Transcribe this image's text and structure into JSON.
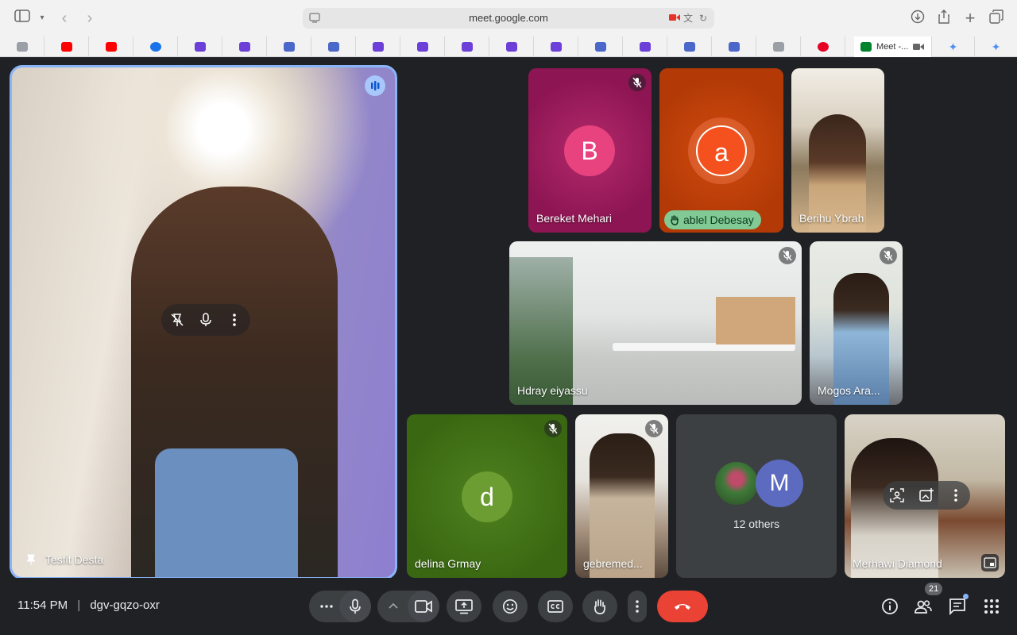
{
  "browser": {
    "url": "meet.google.com",
    "active_tab_title": "Meet -..."
  },
  "meeting": {
    "time": "11:54 PM",
    "separator": "|",
    "code": "dgv-gqzo-oxr",
    "participant_count": "21"
  },
  "participants": {
    "pinned": "Tesfit Desta",
    "bereket": {
      "name": "Bereket Mehari",
      "initial": "B"
    },
    "ablel": {
      "name": "ablel Debesay",
      "initial": "a"
    },
    "berihu": {
      "name": "Berihu Ybrah"
    },
    "hdray": {
      "name": "Hdray eiyassu"
    },
    "mogos": {
      "name": "Mogos Ara..."
    },
    "delina": {
      "name": "delina Grmay",
      "initial": "d"
    },
    "gebremed": {
      "name": "gebremed..."
    },
    "others": {
      "label": "12 others",
      "initial": "M"
    },
    "merhawi": {
      "name": "Merhawi Diamond"
    }
  },
  "colors": {
    "pinned_border": "#8ab4f8",
    "bereket_bg": "#9c1a5c",
    "ablel_bg": "#bf3a06",
    "delina_bg": "#3f6e16",
    "hangup": "#ea4335",
    "hand_badge": "#81c995"
  }
}
